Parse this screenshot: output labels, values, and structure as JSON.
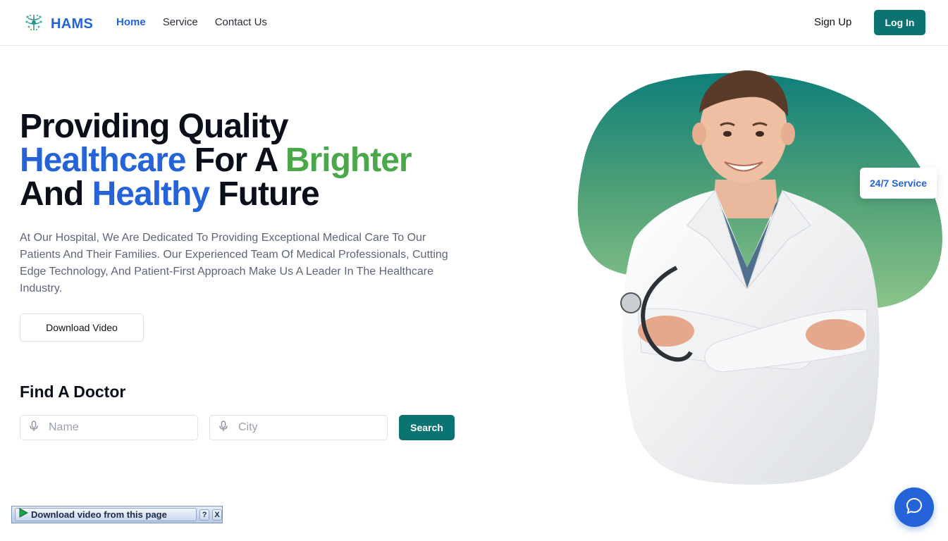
{
  "header": {
    "brand": "HAMS",
    "nav": [
      {
        "label": "Home",
        "active": true
      },
      {
        "label": "Service",
        "active": false
      },
      {
        "label": "Contact Us",
        "active": false
      }
    ],
    "signup_label": "Sign Up",
    "login_label": "Log In"
  },
  "hero": {
    "title_line1": "Providing Quality",
    "title_line2_blue": "Healthcare",
    "title_line2_mid": " For A ",
    "title_line2_green": "Brighter",
    "title_line3_start": "And ",
    "title_line3_blue": "Healthy",
    "title_line3_end": " Future",
    "description": "At Our Hospital, We Are Dedicated To Providing Exceptional Medical Care To Our Patients And Their Families. Our Experienced Team Of Medical Professionals, Cutting Edge Technology, And Patient-First Approach Make Us A Leader In The Healthcare Industry.",
    "download_label": "Download Video"
  },
  "find_doctor": {
    "title": "Find A Doctor",
    "name_placeholder": "Name",
    "city_placeholder": "City",
    "search_label": "Search"
  },
  "badge": {
    "label": "24/7 Service"
  },
  "download_bar": {
    "label": "Download video from this page",
    "help_label": "?",
    "close_label": "X"
  },
  "icons": {
    "logo": "caduceus-icon",
    "mic": "mic-icon",
    "chat": "chat-icon",
    "play": "play-icon"
  },
  "colors": {
    "primary_blue": "#2563d9",
    "accent_green": "#4aa84a",
    "teal_button": "#0c7373",
    "blob_top": "#0f7f7a",
    "blob_bottom": "#8bc48a"
  }
}
